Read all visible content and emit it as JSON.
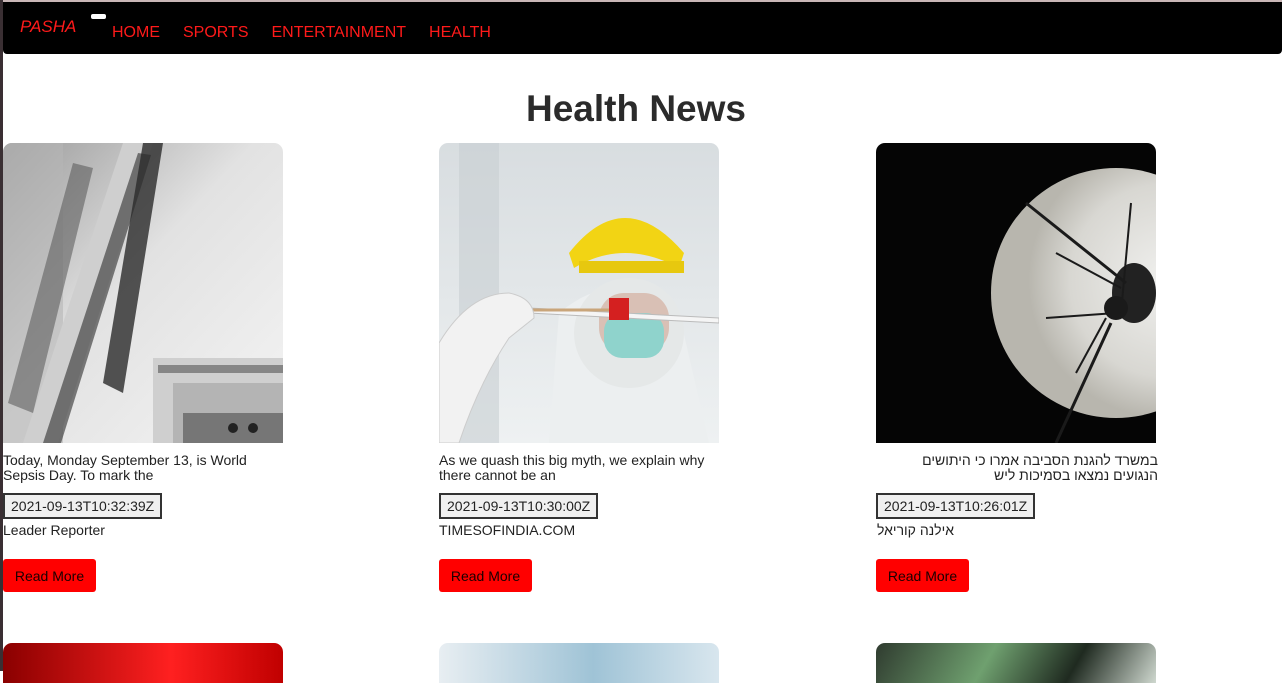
{
  "navbar": {
    "brand": "PASHA",
    "links": [
      "HOME",
      "SPORTS",
      "ENTERTAINMENT",
      "HEALTH"
    ]
  },
  "page": {
    "title": "Health News"
  },
  "articles": [
    {
      "description": "Today, Monday September 13, is World Sepsis Day. To mark the",
      "date": "2021-09-13T10:32:39Z",
      "source": "Leader Reporter",
      "button": "Read More"
    },
    {
      "description": "As we quash this big myth, we explain why there cannot be an",
      "date": "2021-09-13T10:30:00Z",
      "source": "TIMESOFINDIA.COM",
      "button": "Read More"
    },
    {
      "description": "במשרד להגנת הסביבה אמרו כי היתושים הנגועים נמצאו בסמיכות ליש",
      "date": "2021-09-13T10:26:01Z",
      "source": "אילנה קוריאל",
      "button": "Read More"
    }
  ],
  "colors": {
    "navbar_bg": "#000000",
    "nav_text": "#ff1a1a",
    "button_bg": "#ff0000",
    "title_text": "#2b2b2b"
  },
  "icons": [
    "menu-toggle-icon"
  ]
}
